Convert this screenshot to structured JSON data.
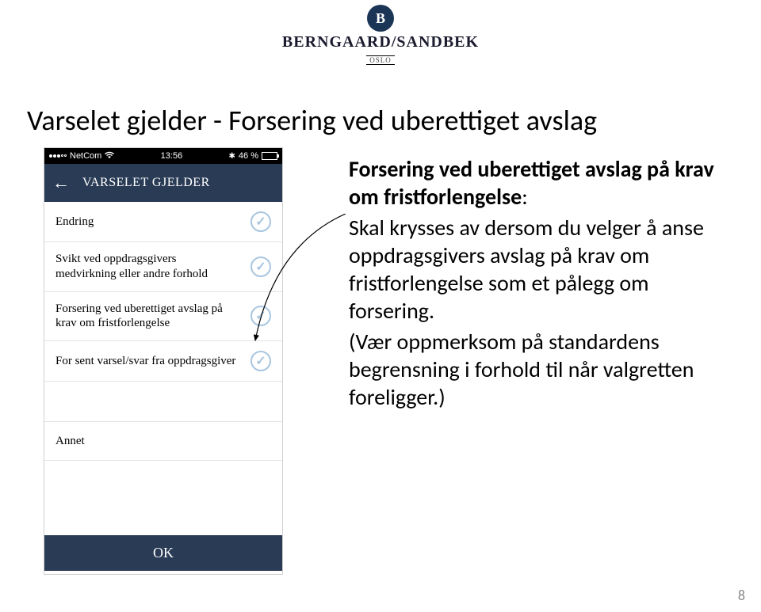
{
  "logo": {
    "letter": "B",
    "company": "BERNGAARD/SANDBEK",
    "city": "OSLO"
  },
  "slide_title": "Varselet gjelder - Forsering ved uberettiget avslag",
  "statusbar": {
    "carrier": "NetCom",
    "time": "13:56",
    "battery_pct": "46 %"
  },
  "nav": {
    "title": "VARSELET GJELDER"
  },
  "rows": {
    "r0": {
      "label": "Endring"
    },
    "r1": {
      "label": "Svikt ved oppdragsgivers medvirkning eller andre forhold"
    },
    "r2": {
      "label": "Forsering ved uberettiget avslag på krav om fristforlengelse"
    },
    "r3": {
      "label": "For sent varsel/svar fra oppdragsgiver"
    },
    "r4": {
      "label": "Annet"
    }
  },
  "ok_label": "OK",
  "body": {
    "heading": "Forsering ved uberettiget avslag på krav om fristforlengelse",
    "para1": "Skal krysses av dersom du velger å anse oppdragsgivers avslag på krav om fristforlengelse som et pålegg om forsering.",
    "para2": "(Vær oppmerksom på standardens begrensning i forhold til når valgretten foreligger.)"
  },
  "page_number": "8"
}
